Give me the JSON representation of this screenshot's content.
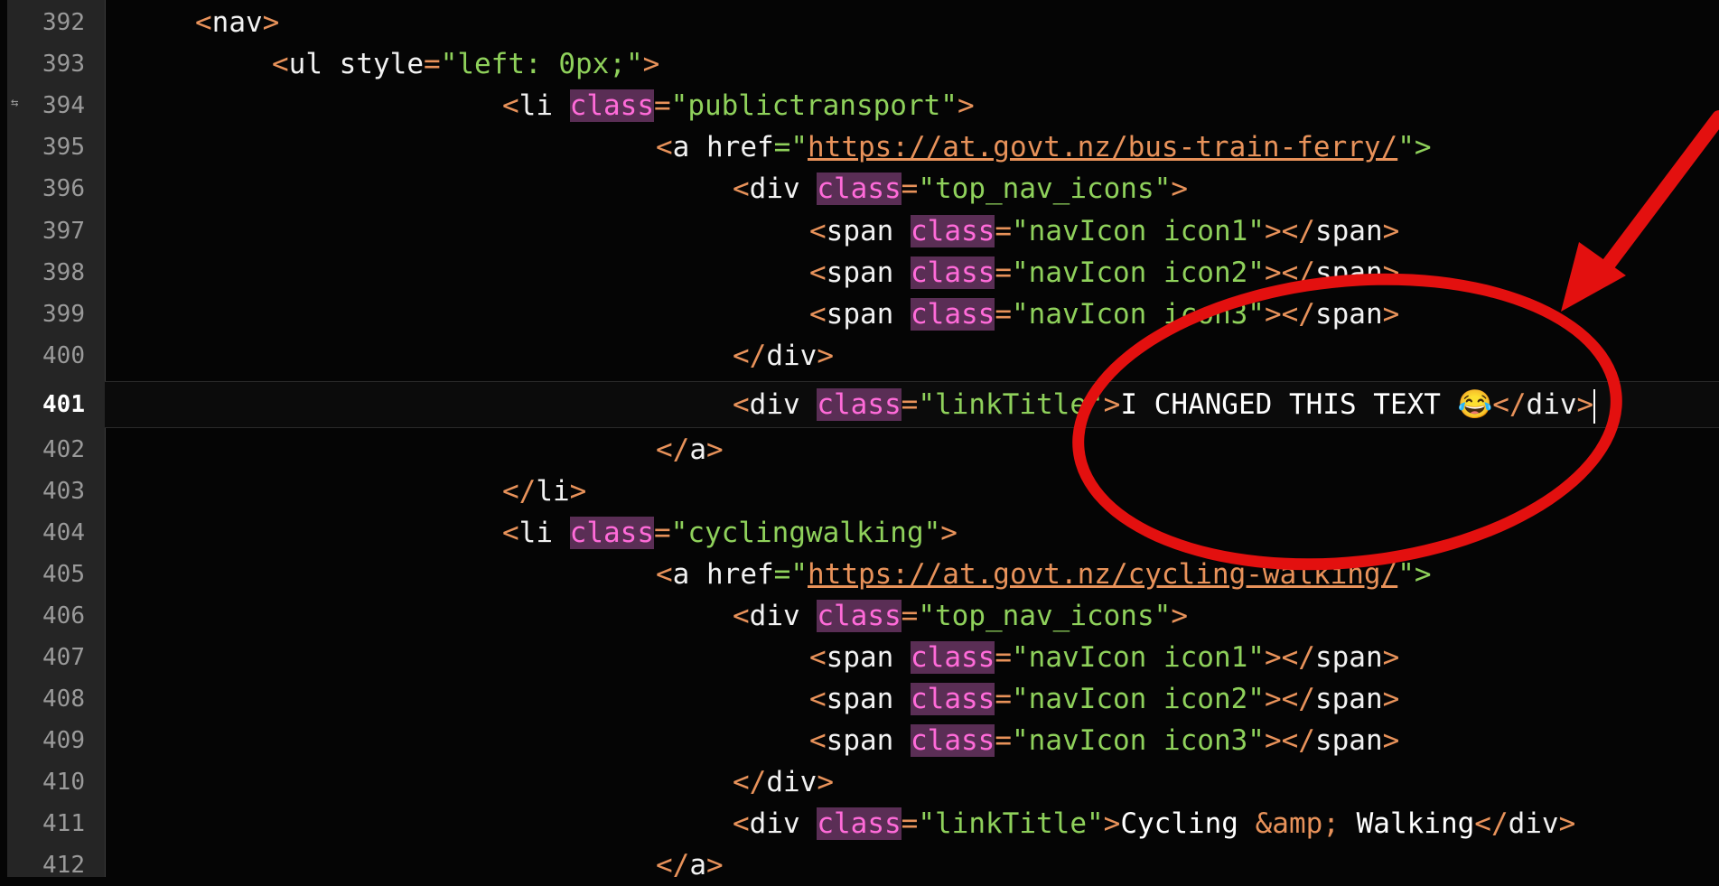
{
  "gutter": {
    "line_numbers": [
      "392",
      "393",
      "394",
      "395",
      "396",
      "397",
      "398",
      "399",
      "400",
      "401",
      "402",
      "403",
      "404",
      "405",
      "406",
      "407",
      "408",
      "409",
      "410",
      "411",
      "412"
    ]
  },
  "code": {
    "l392": {
      "open": "<",
      "tag": "nav",
      "close": ">"
    },
    "l393": {
      "open": "<",
      "tag": "ul",
      "attr": "style",
      "eq": "=",
      "val": "\"left: 0px;\"",
      "close": ">"
    },
    "l394": {
      "open": "<",
      "tag": "li",
      "attr": "class",
      "eq": "=",
      "val": "\"publictransport\"",
      "close": ">"
    },
    "l395": {
      "open": "<",
      "tag": "a",
      "attr": "href",
      "eq": "=\"",
      "url": "https://at.govt.nz/bus-train-ferry/",
      "qclose": "\">"
    },
    "l396": {
      "open": "<",
      "tag": "div",
      "attr": "class",
      "eq": "=",
      "val": "\"top_nav_icons\"",
      "close": ">"
    },
    "l397": {
      "open": "<",
      "tag": "span",
      "attr": "class",
      "eq": "=",
      "val": "\"navIcon icon1\"",
      "close": "></",
      "ctag": "span",
      "end": ">"
    },
    "l398": {
      "open": "<",
      "tag": "span",
      "attr": "class",
      "eq": "=",
      "val": "\"navIcon icon2\"",
      "close": "></",
      "ctag": "span",
      "end": ">"
    },
    "l399": {
      "open": "<",
      "tag": "span",
      "attr": "class",
      "eq": "=",
      "val": "\"navIcon icon3\"",
      "close": "></",
      "ctag": "span",
      "end": ">"
    },
    "l400": {
      "open": "</",
      "tag": "div",
      "close": ">"
    },
    "l401": {
      "open": "<",
      "tag": "div",
      "attr": "class",
      "eq": "=",
      "val": "\"linkTitle\"",
      "close": ">",
      "text": "I CHANGED THIS TEXT 😂",
      "close2": "</",
      "ctag": "div",
      "end": ">"
    },
    "l402": {
      "open": "</",
      "tag": "a",
      "close": ">"
    },
    "l403": {
      "open": "</",
      "tag": "li",
      "close": ">"
    },
    "l404": {
      "open": "<",
      "tag": "li",
      "attr": "class",
      "eq": "=",
      "val": "\"cyclingwalking\"",
      "close": ">"
    },
    "l405": {
      "open": "<",
      "tag": "a",
      "attr": "href",
      "eq": "=\"",
      "url": "https://at.govt.nz/cycling-walking/",
      "qclose": "\">"
    },
    "l406": {
      "open": "<",
      "tag": "div",
      "attr": "class",
      "eq": "=",
      "val": "\"top_nav_icons\"",
      "close": ">"
    },
    "l407": {
      "open": "<",
      "tag": "span",
      "attr": "class",
      "eq": "=",
      "val": "\"navIcon icon1\"",
      "close": "></",
      "ctag": "span",
      "end": ">"
    },
    "l408": {
      "open": "<",
      "tag": "span",
      "attr": "class",
      "eq": "=",
      "val": "\"navIcon icon2\"",
      "close": "></",
      "ctag": "span",
      "end": ">"
    },
    "l409": {
      "open": "<",
      "tag": "span",
      "attr": "class",
      "eq": "=",
      "val": "\"navIcon icon3\"",
      "close": "></",
      "ctag": "span",
      "end": ">"
    },
    "l410": {
      "open": "</",
      "tag": "div",
      "close": ">"
    },
    "l411": {
      "open": "<",
      "tag": "div",
      "attr": "class",
      "eq": "=",
      "val": "\"linkTitle\"",
      "close": ">",
      "text": "Cycling ",
      "ent": "&amp;",
      "text2": " Walking",
      "close2": "</",
      "ctag": "div",
      "end": ">"
    },
    "l412": {
      "open": "</",
      "tag": "a",
      "close": ">"
    }
  },
  "annotation": {
    "color": "#e3100f",
    "shapes": [
      "arrow",
      "ellipse"
    ]
  },
  "colors": {
    "background": "#050505",
    "gutter": "#252525",
    "tag_punct": "#e8925a",
    "string": "#8fd15b",
    "highlight_bg": "#5a2e55",
    "highlight_fg": "#ff6bd9"
  }
}
